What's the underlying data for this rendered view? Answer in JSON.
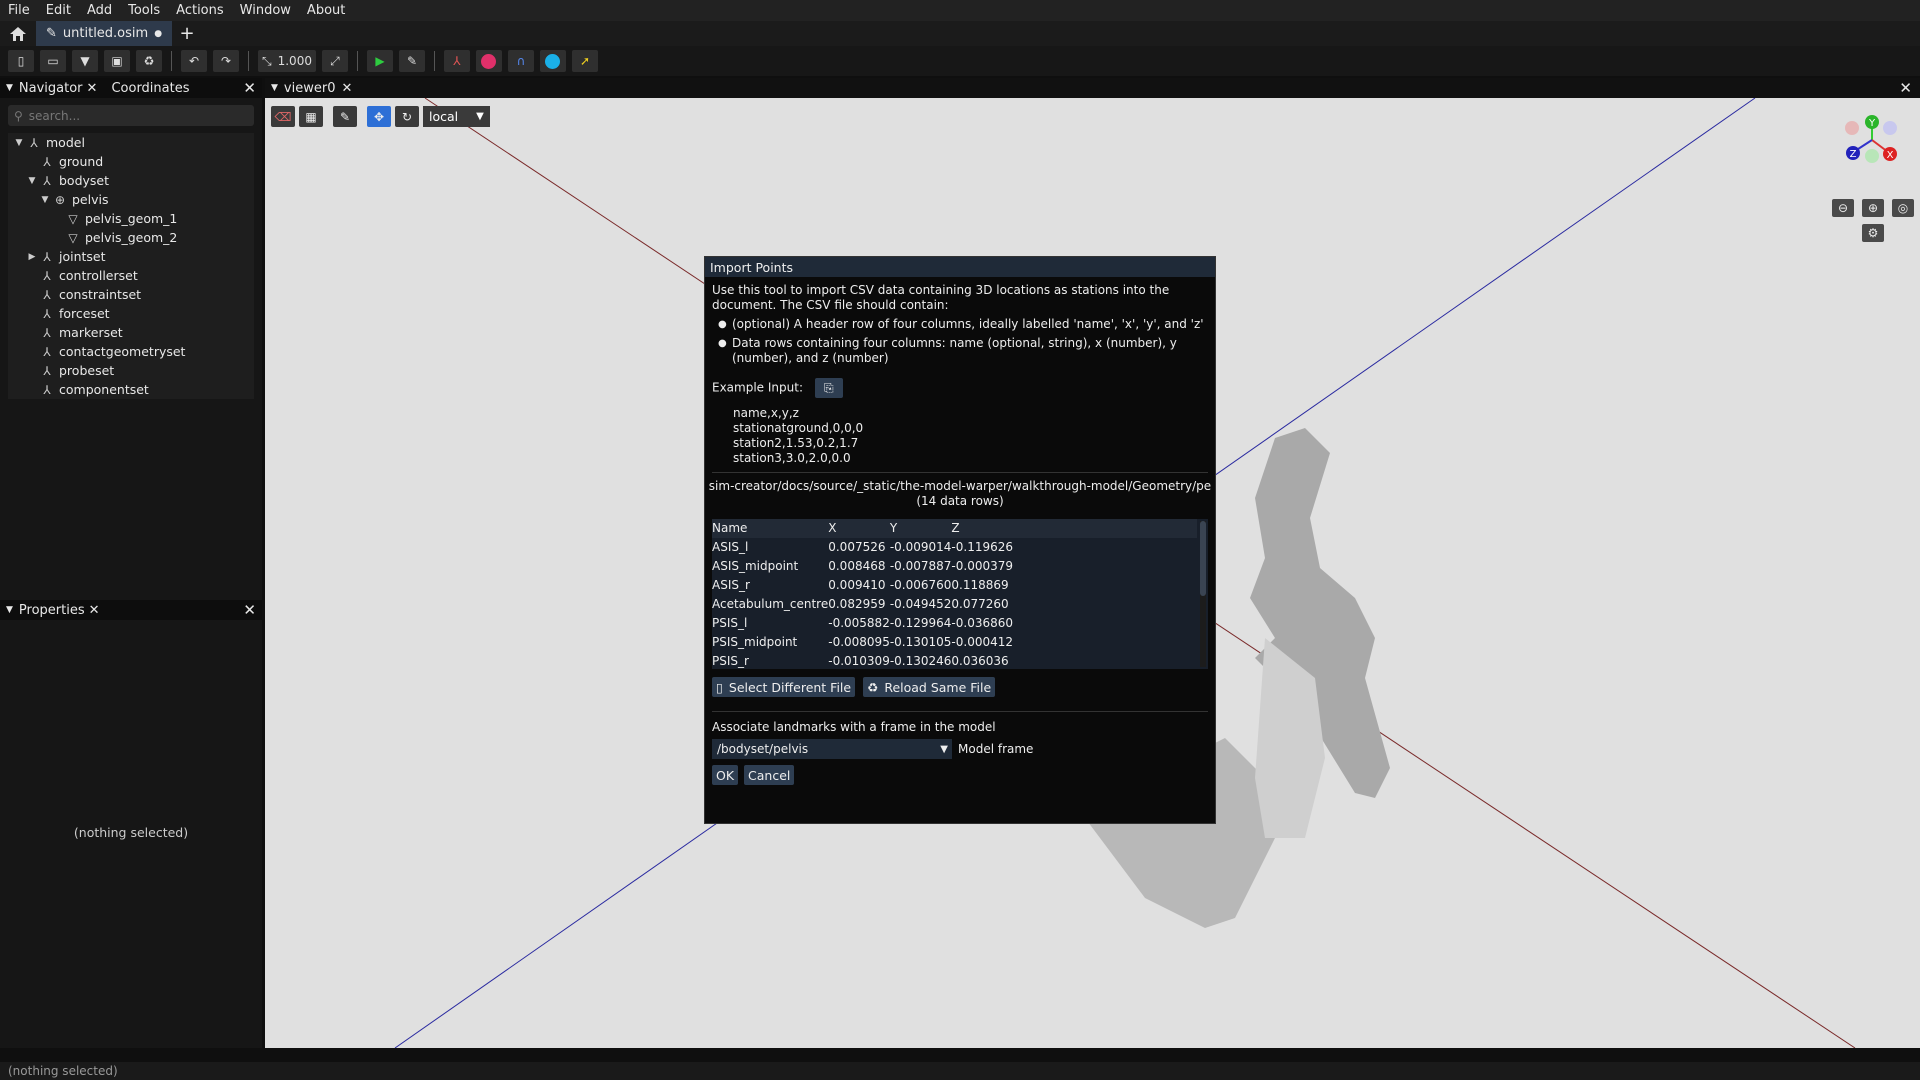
{
  "menu": [
    "File",
    "Edit",
    "Add",
    "Tools",
    "Actions",
    "Window",
    "About"
  ],
  "tab": {
    "filename": "untitled.osim",
    "modified_dot": "●",
    "add": "+"
  },
  "toolbar": {
    "scale_value": "1.000"
  },
  "navigator": {
    "tab1": "Navigator",
    "tab2": "Coordinates",
    "search_placeholder": "search...",
    "items": [
      {
        "label": "model",
        "level": 0,
        "arrow": "▼"
      },
      {
        "label": "ground",
        "level": 1,
        "arrow": ""
      },
      {
        "label": "bodyset",
        "level": 1,
        "arrow": "▼"
      },
      {
        "label": "pelvis",
        "level": 2,
        "arrow": "▼"
      },
      {
        "label": "pelvis_geom_1",
        "level": 3,
        "arrow": ""
      },
      {
        "label": "pelvis_geom_2",
        "level": 3,
        "arrow": ""
      },
      {
        "label": "jointset",
        "level": 1,
        "arrow": "▶"
      },
      {
        "label": "controllerset",
        "level": 1,
        "arrow": ""
      },
      {
        "label": "constraintset",
        "level": 1,
        "arrow": ""
      },
      {
        "label": "forceset",
        "level": 1,
        "arrow": ""
      },
      {
        "label": "markerset",
        "level": 1,
        "arrow": ""
      },
      {
        "label": "contactgeometryset",
        "level": 1,
        "arrow": ""
      },
      {
        "label": "probeset",
        "level": 1,
        "arrow": ""
      },
      {
        "label": "componentset",
        "level": 1,
        "arrow": ""
      }
    ]
  },
  "properties": {
    "title": "Properties",
    "empty": "(nothing selected)"
  },
  "status": "(nothing selected)",
  "viewer": {
    "title": "viewer0",
    "frame": "local"
  },
  "gizmo": {
    "y": "Y",
    "x": "X",
    "z": "Z"
  },
  "dialog": {
    "title": "Import Points",
    "intro": "Use this tool to import CSV data containing 3D locations as stations into the document. The CSV file should contain:",
    "bullet1": "(optional) A header row of four columns, ideally labelled 'name', 'x', 'y', and 'z'",
    "bullet2": "Data rows containing four columns: name (optional, string), x (number), y (number), and z (number)",
    "example_label": "Example Input:",
    "example_lines": [
      "name,x,y,z",
      "stationatground,0,0,0",
      "station2,1.53,0.2,1.7",
      "station3,3.0,2.0,0.0"
    ],
    "path": "sim-creator/docs/source/_static/the-model-warper/walkthrough-model/Geometry/pe",
    "row_count": "(14 data rows)",
    "columns": [
      "Name",
      "X",
      "Y",
      "Z"
    ],
    "rows": [
      [
        "ASIS_l",
        "0.007526",
        "-0.009014",
        "-0.119626"
      ],
      [
        "ASIS_midpoint",
        "0.008468",
        "-0.007887",
        "-0.000379"
      ],
      [
        "ASIS_r",
        "0.009410",
        "-0.006760",
        "0.118869"
      ],
      [
        "Acetabulum_centre",
        "0.082959",
        "-0.049452",
        "0.077260"
      ],
      [
        "PSIS_l",
        "-0.005882",
        "-0.129964",
        "-0.036860"
      ],
      [
        "PSIS_midpoint",
        "-0.008095",
        "-0.130105",
        "-0.000412"
      ],
      [
        "PSIS_r",
        "-0.010309",
        "-0.130246",
        "0.036036"
      ]
    ],
    "select_btn": "Select Different File",
    "reload_btn": "Reload Same File",
    "assoc_label": "Associate landmarks with a frame in the model",
    "frame_value": "/bodyset/pelvis",
    "frame_label": "Model frame",
    "ok": "OK",
    "cancel": "Cancel"
  }
}
